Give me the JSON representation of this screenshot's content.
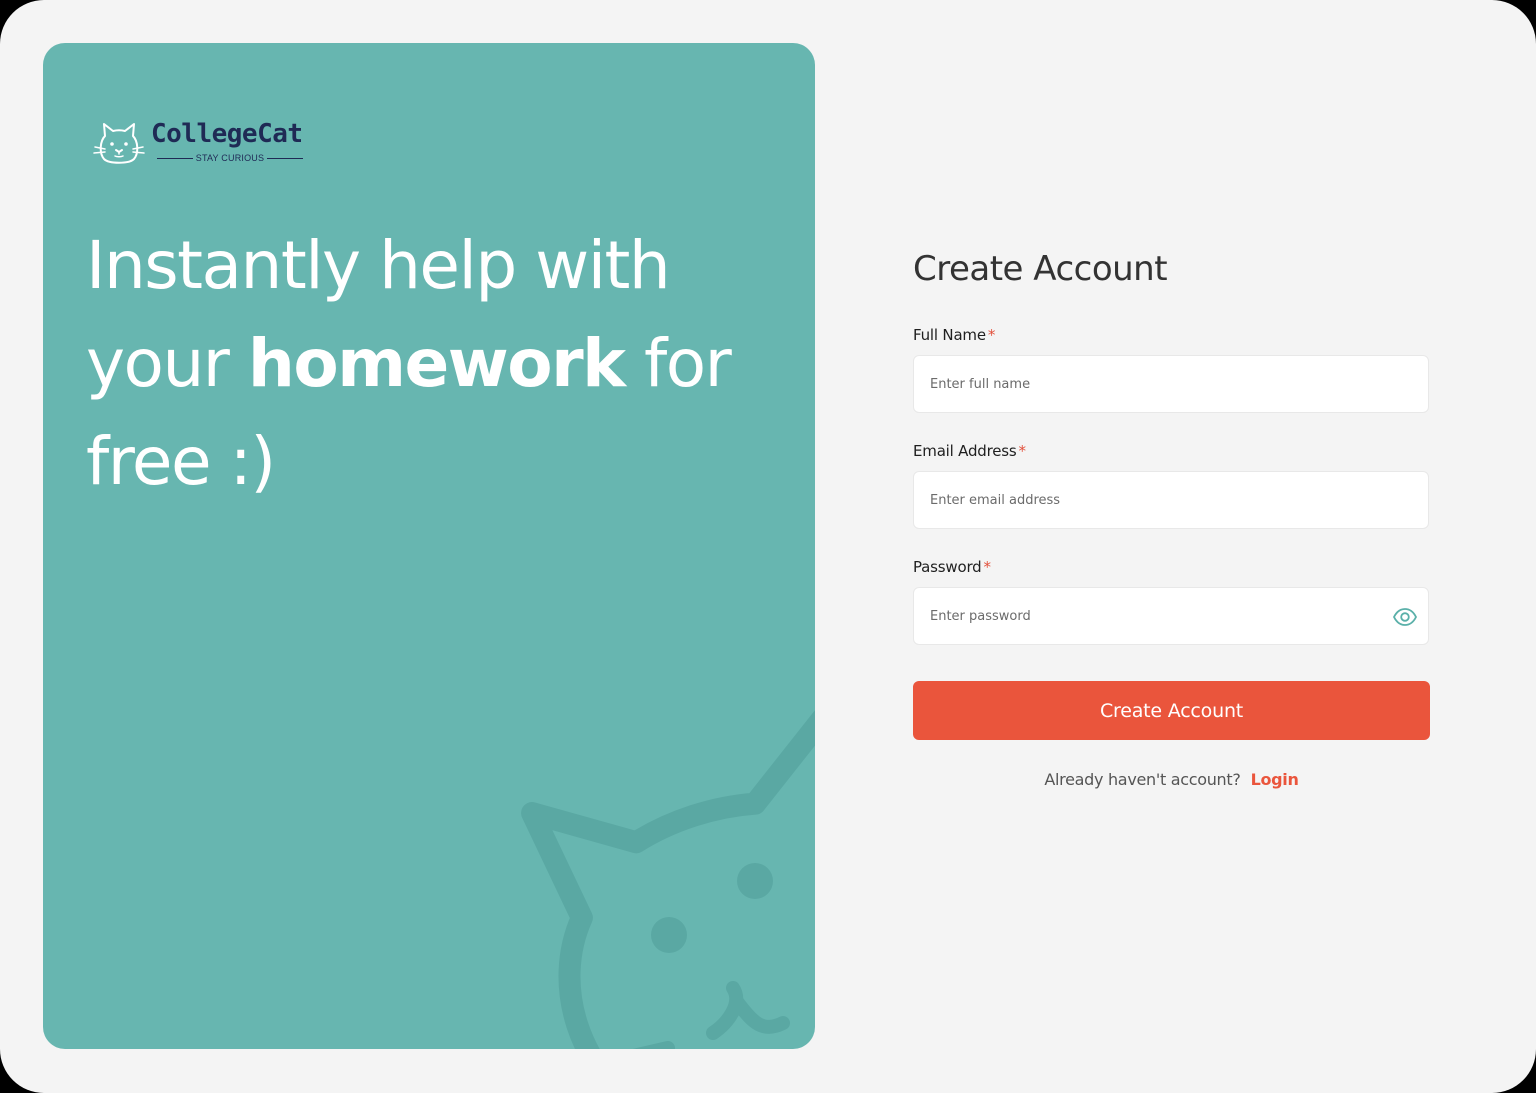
{
  "brand": {
    "name": "CollegeCat",
    "tagline": "STAY CURIOUS"
  },
  "hero": {
    "line1": "Instantly help with",
    "line2_pre": "your ",
    "line2_bold": "homework",
    "line2_post": " for",
    "line3": "free :)"
  },
  "form": {
    "title": "Create Account",
    "required_mark": "*",
    "full_name": {
      "label": "Full Name",
      "placeholder": "Enter full name"
    },
    "email": {
      "label": "Email Address",
      "placeholder": "Enter email address"
    },
    "password": {
      "label": "Password",
      "placeholder": "Enter password"
    },
    "submit_label": "Create Account",
    "login_prompt": "Already haven't account?",
    "login_link": "Login"
  },
  "colors": {
    "hero_bg": "#67b6b0",
    "accent": "#ea553c",
    "brand_navy": "#1f2a55",
    "page_bg": "#f4f4f4"
  },
  "icons": {
    "logo": "cat-head-icon",
    "password_toggle": "eye-icon",
    "watermark": "cat-head-watermark-icon"
  }
}
